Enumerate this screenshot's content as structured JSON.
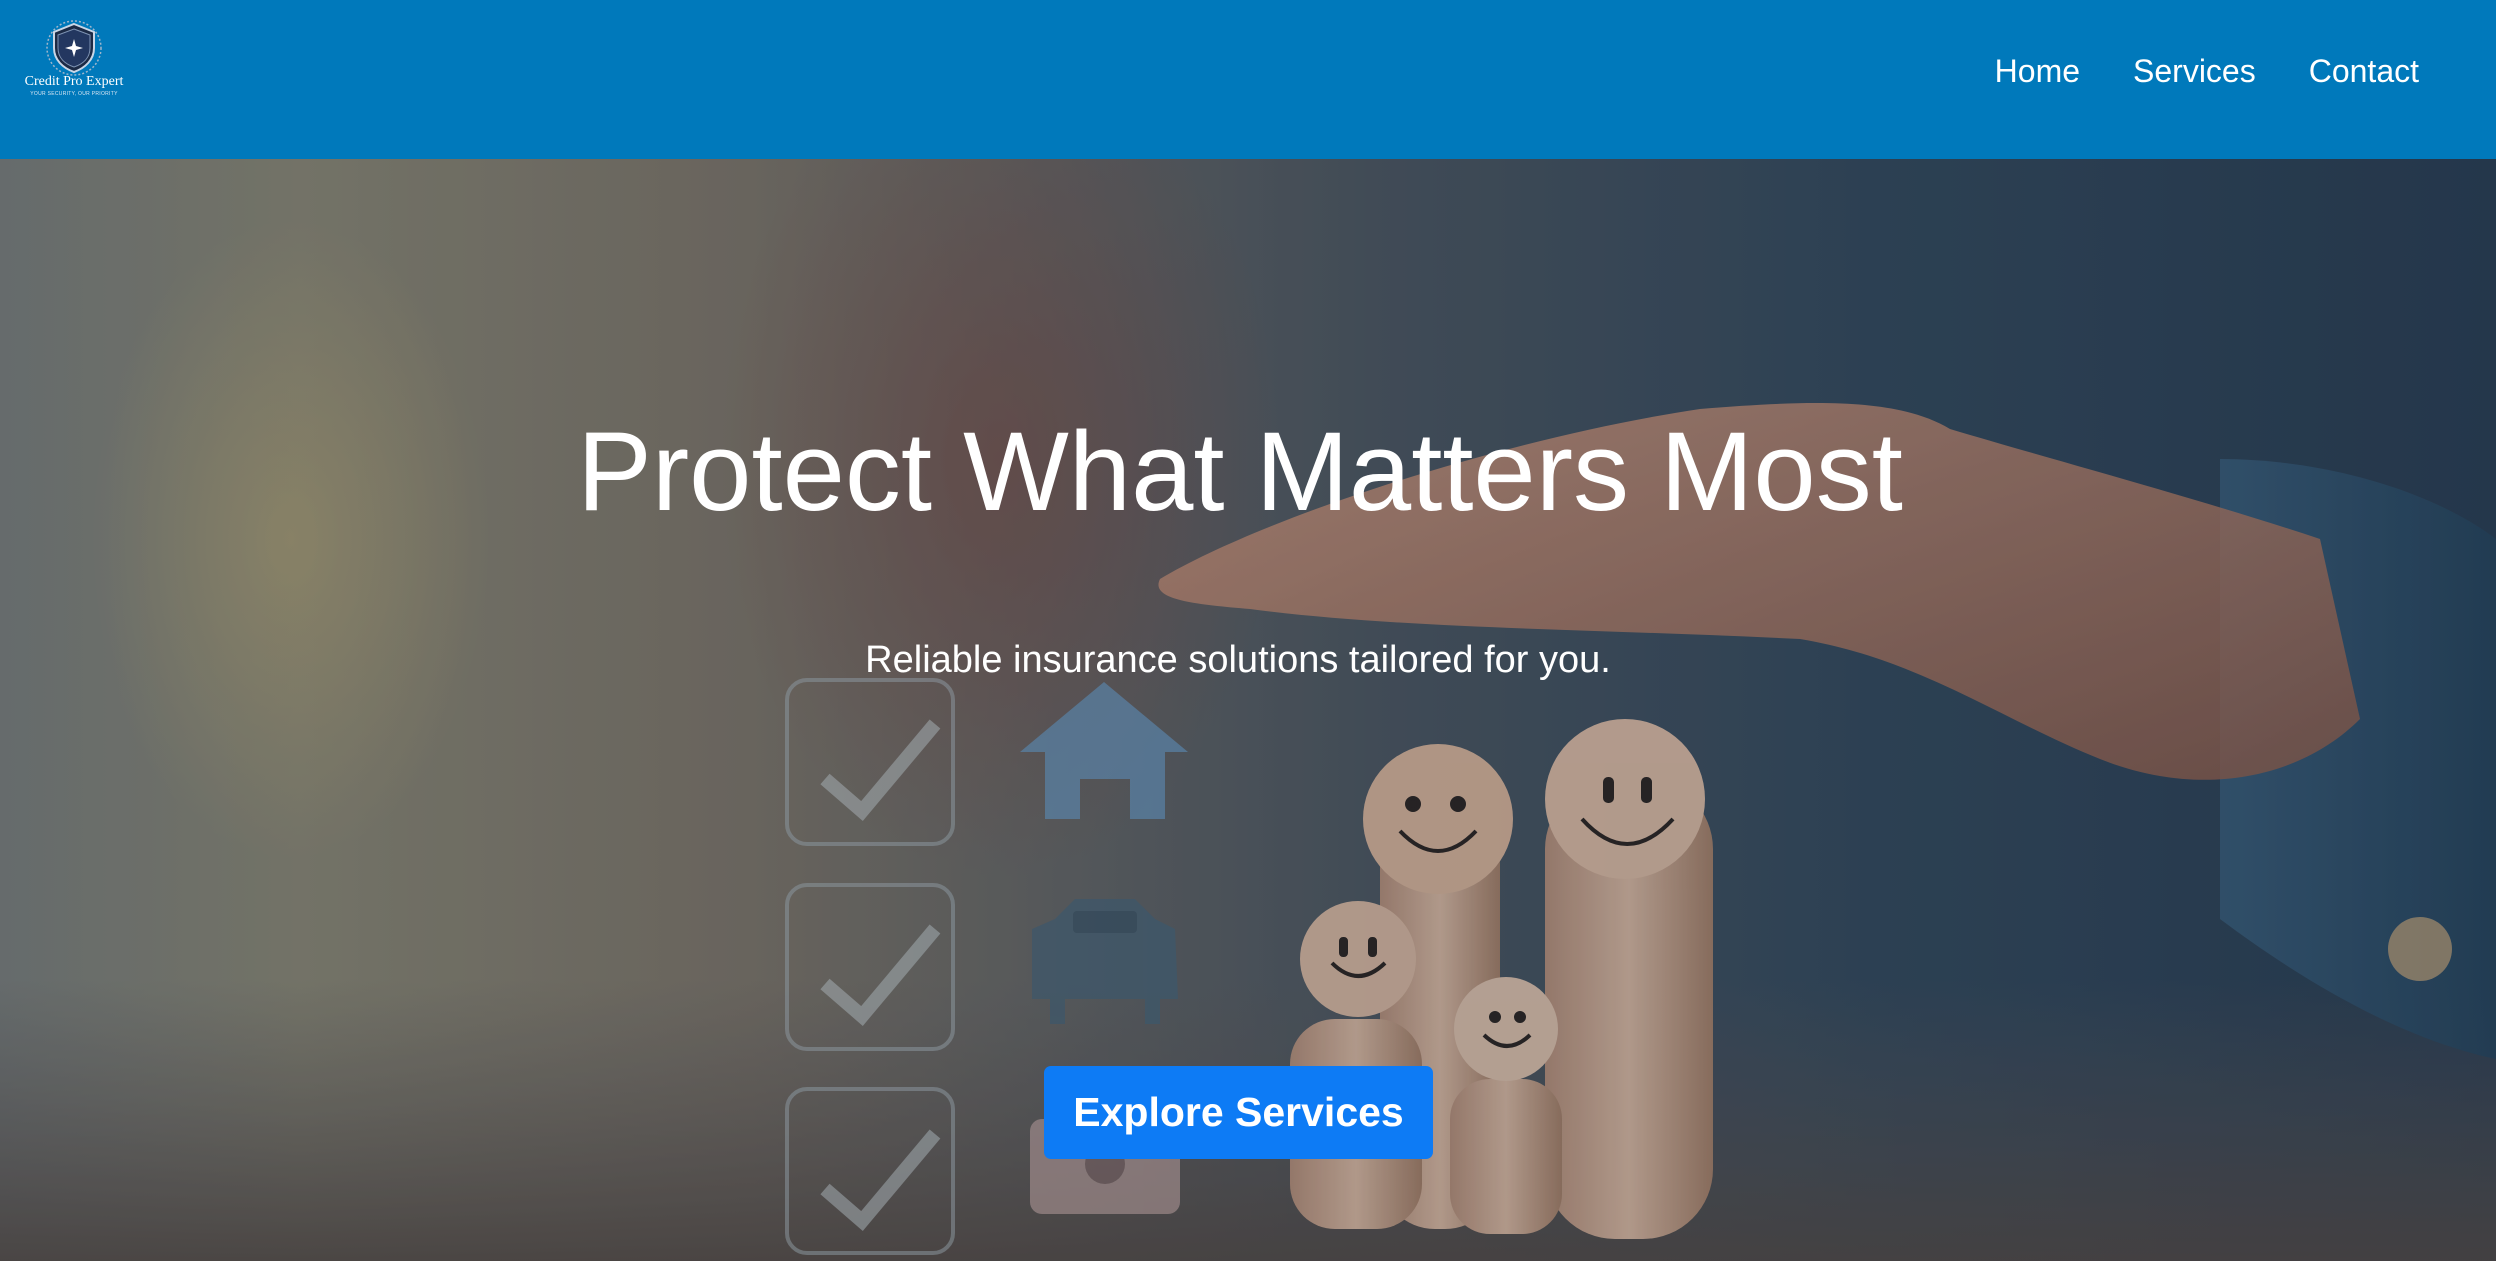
{
  "brand": {
    "name": "Credit Pro Expert",
    "tagline": "YOUR SECURITY, OUR PRIORITY",
    "logo_icon": "shield-icon"
  },
  "nav": {
    "items": [
      {
        "label": "Home"
      },
      {
        "label": "Services"
      },
      {
        "label": "Contact"
      }
    ]
  },
  "hero": {
    "title": "Protect What Matters Most",
    "subtitle": "Reliable insurance solutions tailored for you.",
    "cta_label": "Explore Services",
    "icons": [
      "checkbox-icon",
      "checkbox-icon",
      "checkbox-icon",
      "house-icon",
      "car-icon",
      "medical-bag-icon"
    ]
  },
  "colors": {
    "header_bg": "#0079bb",
    "cta_bg": "#0d7bf5",
    "text": "#ffffff"
  }
}
